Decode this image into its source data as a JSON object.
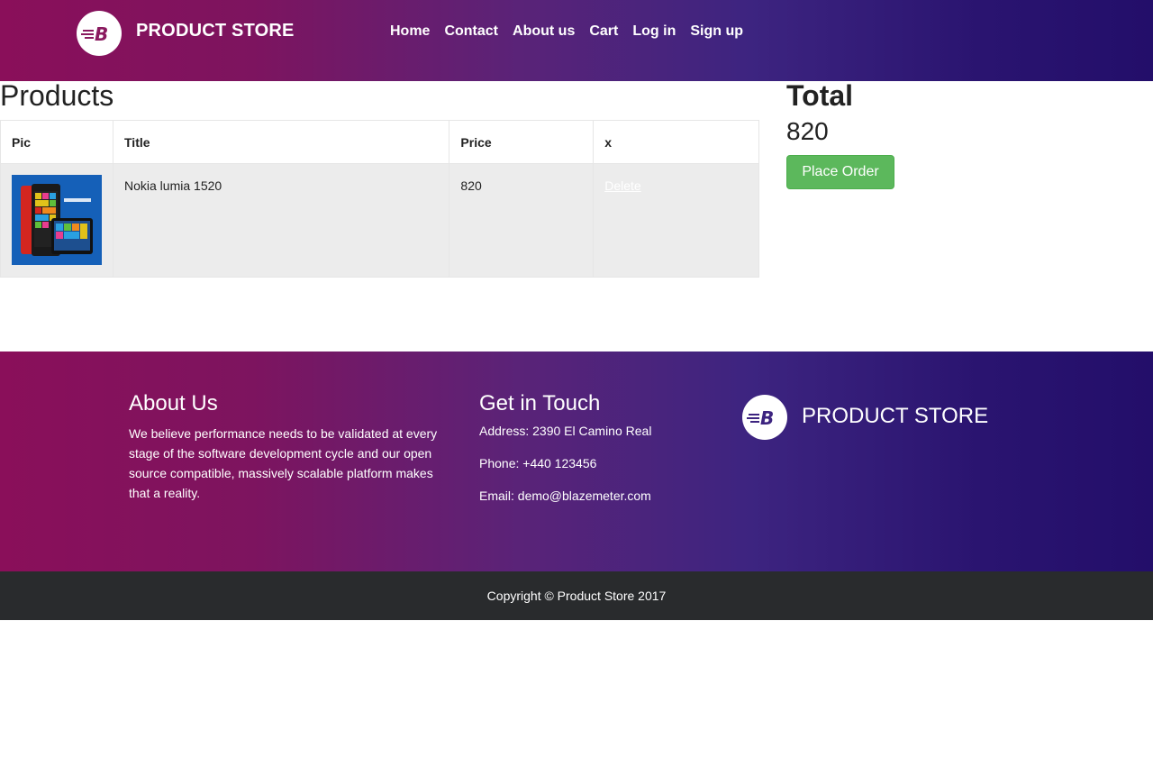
{
  "header": {
    "brand": "PRODUCT STORE",
    "logo_icon": "blazemeter-logo-icon",
    "nav": [
      "Home",
      "Contact",
      "About us",
      "Cart",
      "Log in",
      "Sign up"
    ]
  },
  "products": {
    "title": "Products",
    "columns": [
      "Pic",
      "Title",
      "Price",
      "x"
    ],
    "rows": [
      {
        "title": "Nokia lumia 1520",
        "price": "820",
        "action": "Delete",
        "pic_icon": "nokia-lumia-phone-image"
      }
    ]
  },
  "total": {
    "label": "Total",
    "value": "820",
    "button": "Place Order"
  },
  "footer": {
    "about_title": "About Us",
    "about_text": "We believe performance needs to be validated at every stage of the software development cycle and our open source compatible, massively scalable platform makes that a reality.",
    "touch_title": "Get in Touch",
    "address": "Address: 2390 El Camino Real",
    "phone": "Phone: +440 123456",
    "email": "Email: demo@blazemeter.com",
    "brand": "PRODUCT STORE",
    "copyright": "Copyright © Product Store 2017"
  },
  "colors": {
    "gradient_start": "#8a0f5a",
    "gradient_end": "#230e6a",
    "place_order": "#5cb85c",
    "copyright_bg": "#292b2d",
    "row_bg": "#ececec"
  }
}
